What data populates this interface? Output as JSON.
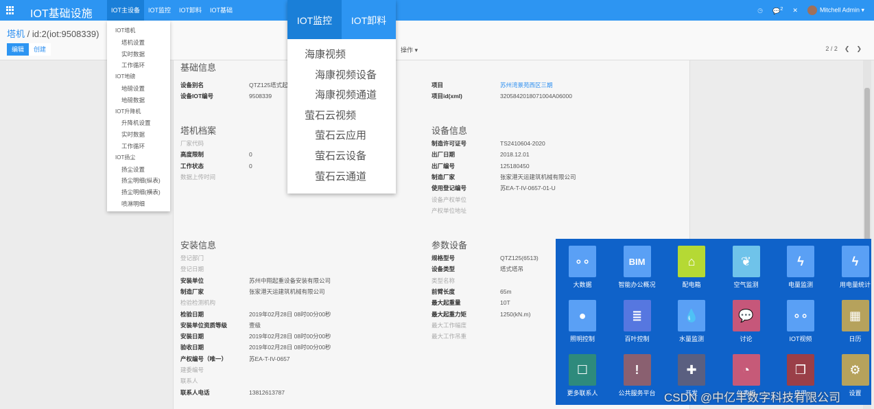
{
  "topbar": {
    "title": "IOT基础设施",
    "menu": [
      "IOT主设备",
      "IOT监控",
      "IOT卸料",
      "IOT基础"
    ],
    "chat_count": "2",
    "user": "Mitchell Admin",
    "accent": "#2d95f2"
  },
  "control": {
    "breadcrumb_parent": "塔机",
    "breadcrumb_current": " / id:2(iot:9508339)",
    "edit": "编辑",
    "create": "创建",
    "actions": "操作 ▾",
    "pager": "2 / 2"
  },
  "dropdown_main": [
    {
      "t": "g",
      "label": "IOT塔机"
    },
    {
      "t": "i",
      "label": "塔机设置"
    },
    {
      "t": "i",
      "label": "实时数据"
    },
    {
      "t": "i",
      "label": "工作循环"
    },
    {
      "t": "g",
      "label": "IOT地磅"
    },
    {
      "t": "i",
      "label": "地磅设置"
    },
    {
      "t": "i",
      "label": "地磅数据"
    },
    {
      "t": "g",
      "label": "IOT升降机"
    },
    {
      "t": "i",
      "label": "升降机设置"
    },
    {
      "t": "i",
      "label": "实时数据"
    },
    {
      "t": "i",
      "label": "工作循环"
    },
    {
      "t": "g",
      "label": "IOT扬尘"
    },
    {
      "t": "i",
      "label": "扬尘设置"
    },
    {
      "t": "i",
      "label": "扬尘明细(纵表)"
    },
    {
      "t": "i",
      "label": "扬尘明细(横表)"
    },
    {
      "t": "i",
      "label": "喷淋明细"
    }
  ],
  "dropdown_monitor": {
    "tabs": [
      "IOT监控",
      "IOT卸料"
    ],
    "items": [
      {
        "t": "g",
        "label": "海康视频"
      },
      {
        "t": "s",
        "label": "海康视频设备"
      },
      {
        "t": "s",
        "label": "海康视频通道"
      },
      {
        "t": "g",
        "label": "萤石云视频"
      },
      {
        "t": "s",
        "label": "萤石云应用"
      },
      {
        "t": "s",
        "label": "萤石云设备"
      },
      {
        "t": "s",
        "label": "萤石云通道"
      }
    ]
  },
  "form": {
    "basic": {
      "title": "基础信息",
      "fields": [
        {
          "l": "设备别名",
          "v": "QTZ125塔式起"
        },
        {
          "l": "设备IOT编号",
          "v": "9508339"
        }
      ]
    },
    "project": {
      "fields": [
        {
          "l": "项目",
          "v": "苏州湾景苑西区三期",
          "link": true
        },
        {
          "l": "项目id(xml)",
          "v": "3205842018071004A06000"
        }
      ]
    },
    "archive": {
      "title": "塔机档案",
      "fields": [
        {
          "l": "厂家代码",
          "v": "",
          "m": true
        },
        {
          "l": "高度限制",
          "v": "0"
        },
        {
          "l": "工作状态",
          "v": "0"
        },
        {
          "l": "数据上传时间",
          "v": "",
          "m": true
        }
      ]
    },
    "device": {
      "title": "设备信息",
      "fields": [
        {
          "l": "制造许可证号",
          "v": "TS2410604-2020"
        },
        {
          "l": "出厂日期",
          "v": "2018.12.01"
        },
        {
          "l": "出厂编号",
          "v": "125180450"
        },
        {
          "l": "制造厂家",
          "v": "张家港天运建筑机械有限公司"
        },
        {
          "l": "使用登记编号",
          "v": "苏EA-T-IV-0657-01-U"
        },
        {
          "l": "设备产权单位",
          "v": "",
          "m": true
        },
        {
          "l": "产权单位地址",
          "v": "",
          "m": true
        }
      ]
    },
    "install": {
      "title": "安装信息",
      "fields": [
        {
          "l": "登记部门",
          "v": "",
          "m": true
        },
        {
          "l": "登记日期",
          "v": "",
          "m": true
        },
        {
          "l": "安装单位",
          "v": "苏州中翔起重设备安装有限公司"
        },
        {
          "l": "制造厂家",
          "v": "张家港天运建筑机械有限公司"
        },
        {
          "l": "检验检测机构",
          "v": "",
          "m": true
        },
        {
          "l": "检验日期",
          "v": "2019年02月28日 08时00分00秒"
        },
        {
          "l": "安装单位资质等级",
          "v": "壹级"
        },
        {
          "l": "安装日期",
          "v": "2019年02月28日 08时00分00秒"
        },
        {
          "l": "验收日期",
          "v": "2019年02月28日 08时00分00秒"
        },
        {
          "l": "产权编号（唯一）",
          "v": "苏EA-T-IV-0657"
        },
        {
          "l": "建委编号",
          "v": "",
          "m": true
        },
        {
          "l": "联系人",
          "v": "",
          "m": true
        },
        {
          "l": "联系人电话",
          "v": "13812613787"
        }
      ]
    },
    "params": {
      "title": "参数设备",
      "fields": [
        {
          "l": "规格型号",
          "v": "QTZ125(6513)"
        },
        {
          "l": "设备类型",
          "v": "塔式塔吊"
        },
        {
          "l": "类型名称",
          "v": "",
          "m": true
        },
        {
          "l": "前臂长度",
          "v": "65m"
        },
        {
          "l": "最大起重量",
          "v": "10T"
        },
        {
          "l": "最大起重力矩",
          "v": "1250(kN.m)"
        },
        {
          "l": "最大工作幅度",
          "v": "",
          "m": true
        },
        {
          "l": "最大工作吊重",
          "v": "",
          "m": true
        }
      ]
    }
  },
  "apps": [
    {
      "label": "大数据",
      "icon": "nodes-icon",
      "glyph": "∘∘",
      "color": "#5aa0f5"
    },
    {
      "label": "智能办公概况",
      "icon": "bim-icon",
      "glyph": "BIM",
      "color": "#5aa0f5"
    },
    {
      "label": "配电箱",
      "icon": "house-bolt-icon",
      "glyph": "⌂",
      "color": "#b5d934"
    },
    {
      "label": "空气监测",
      "icon": "leaf-icon",
      "glyph": "❦",
      "color": "#6fc3ea"
    },
    {
      "label": "电量监测",
      "icon": "bolt-icon",
      "glyph": "ϟ",
      "color": "#5aa0f5"
    },
    {
      "label": "用电量统计",
      "icon": "bolt-icon",
      "glyph": "ϟ",
      "color": "#5aa0f5"
    },
    {
      "label": "照明控制",
      "icon": "bulb-icon",
      "glyph": "●",
      "color": "#5aa0f5"
    },
    {
      "label": "百叶控制",
      "icon": "blinds-icon",
      "glyph": "≣",
      "color": "#5677e0"
    },
    {
      "label": "水量监测",
      "icon": "drop-icon",
      "glyph": "💧",
      "color": "#5aa0f5"
    },
    {
      "label": "讨论",
      "icon": "chat-icon",
      "glyph": "💬",
      "color": "#c6577a"
    },
    {
      "label": "IOT视频",
      "icon": "nodes-icon",
      "glyph": "∘∘",
      "color": "#5aa0f5"
    },
    {
      "label": "日历",
      "icon": "calendar-icon",
      "glyph": "▦",
      "color": "#b6a25c"
    },
    {
      "label": "更多联系人",
      "icon": "contacts-icon",
      "glyph": "☐",
      "color": "#2e8a7c"
    },
    {
      "label": "公共服务平台",
      "icon": "box-icon",
      "glyph": "!",
      "color": "#8a6070"
    },
    {
      "label": "开发",
      "icon": "puzzle-icon",
      "glyph": "✚",
      "color": "#5a5f80"
    },
    {
      "label": "仪表板",
      "icon": "gauge-icon",
      "glyph": "◔",
      "color": "#c65a78"
    },
    {
      "label": "应用",
      "icon": "cubes-icon",
      "glyph": "❒",
      "color": "#9a3f48"
    },
    {
      "label": "设置",
      "icon": "gear-icon",
      "glyph": "⚙",
      "color": "#b6a25c"
    }
  ],
  "watermark": "CSDN @中亿丰数字科技有限公司"
}
